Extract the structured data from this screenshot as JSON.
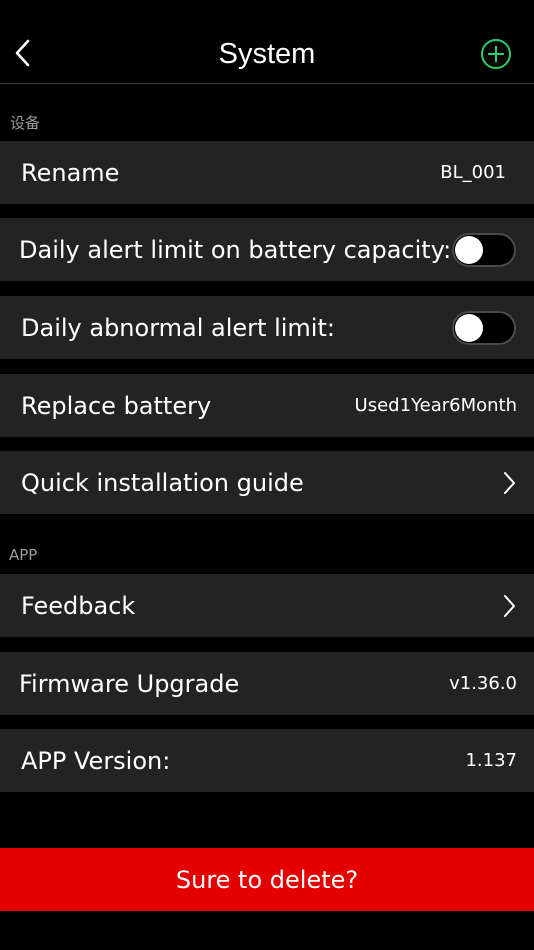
{
  "header": {
    "title": "System",
    "back_icon": "chevron-left-icon",
    "add_icon": "plus-circle-icon",
    "accent_color": "#2ecc71"
  },
  "sections": {
    "device_label": "设备",
    "app_label": "APP"
  },
  "rows": {
    "rename": {
      "label": "Rename",
      "value": "BL_001"
    },
    "daily_capacity_alert": {
      "label": "Daily alert limit on battery capacity:",
      "enabled": false
    },
    "daily_abnormal_alert": {
      "label": "Daily abnormal alert limit:",
      "enabled": false
    },
    "replace_battery": {
      "label": "Replace battery",
      "value": "Used1Year6Month"
    },
    "quick_guide": {
      "label": "Quick installation guide"
    },
    "feedback": {
      "label": "Feedback"
    },
    "firmware": {
      "label": "Firmware Upgrade",
      "value": "v1.36.0"
    },
    "app_version": {
      "label": "APP Version:",
      "value": "1.137"
    }
  },
  "actions": {
    "delete_label": "Sure to delete?",
    "delete_color": "#e50000"
  }
}
